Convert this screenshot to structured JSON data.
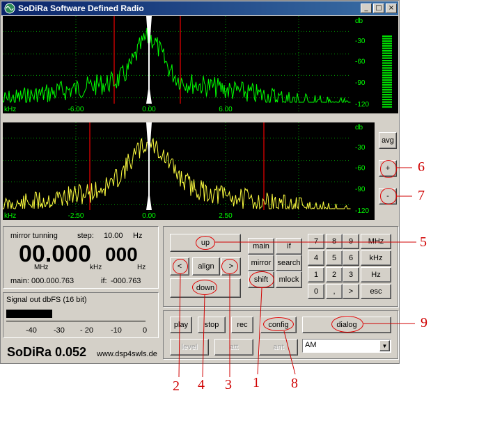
{
  "window": {
    "title": "SoDiRa Software Defined Radio",
    "controls": [
      "_",
      "□",
      "×"
    ]
  },
  "spectrum_top": {
    "unit_x": "kHz",
    "unit_y": "db",
    "x_ticks": [
      "-6.00",
      "0.00",
      "6.00"
    ],
    "y_ticks": [
      "-30",
      "-60",
      "-90",
      "-120"
    ],
    "trace_color": "#00ff00",
    "grid_color": "#00a000",
    "marker_color": "#c00000"
  },
  "spectrum_bottom": {
    "unit_x": "kHz",
    "unit_y": "db",
    "x_ticks": [
      "-2.50",
      "0.00",
      "2.50"
    ],
    "y_ticks": [
      "-30",
      "-60",
      "-90",
      "-120"
    ],
    "trace_color": "#ffff40"
  },
  "side_buttons": {
    "avg": "avg",
    "plus": "+",
    "minus": "-"
  },
  "freq_panel": {
    "mirror_label": "mirror tunning",
    "step_label": "step:",
    "step_value": "10.00",
    "step_unit": "Hz",
    "freq_main": "00.000",
    "freq_dot": ".",
    "freq_small": "000",
    "unit_mhz": "MHz",
    "unit_khz": "kHz",
    "unit_hz": "Hz",
    "main_label": "main:",
    "main_value": "000.000.763",
    "if_label": "if:",
    "if_value": "-000.763"
  },
  "signal_panel": {
    "title": "Signal out dbFS (16 bit)",
    "ticks": [
      "-40",
      "-30",
      "- 20",
      "-10",
      "0"
    ]
  },
  "branding": {
    "name": "SoDiRa 0.052",
    "url": "www.dsp4swls.de"
  },
  "nav_buttons": {
    "up": "up",
    "left": "<",
    "align": "align",
    "right": ">",
    "down": "down"
  },
  "mode_buttons": {
    "main": "main",
    "if": "if",
    "mirror": "mirror",
    "search": "search",
    "shift": "shift",
    "mlock": "mlock"
  },
  "keypad": [
    [
      "7",
      "8",
      "9",
      "MHz"
    ],
    [
      "4",
      "5",
      "6",
      "kHz"
    ],
    [
      "1",
      "2",
      "3",
      "Hz"
    ],
    [
      "0",
      ",",
      ">",
      "esc"
    ]
  ],
  "transport": {
    "play": "play",
    "stop": "stop",
    "rec": "rec",
    "config": "config",
    "dialog": "dialog"
  },
  "disabled_buttons": {
    "level": "level",
    "att": "att",
    "ant": "ant"
  },
  "mode_select": {
    "value": "AM"
  },
  "annotations": {
    "n1": "1",
    "n2": "2",
    "n3": "3",
    "n4": "4",
    "n5": "5",
    "n6": "6",
    "n7": "7",
    "n8": "8",
    "n9": "9"
  }
}
